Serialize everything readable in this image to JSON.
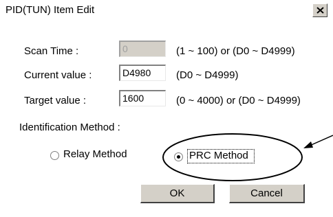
{
  "window": {
    "title": "PID(TUN) Item Edit",
    "close_glyph": "×"
  },
  "fields": {
    "scan_time": {
      "label": "Scan Time :",
      "value": "0",
      "range": "(1 ~ 100) or (D0 ~ D4999)",
      "disabled": true
    },
    "current_value": {
      "label": "Current value :",
      "value": "D4980",
      "range": "(D0 ~ D4999)"
    },
    "target_value": {
      "label": "Target value :",
      "value": "1600",
      "range": "(0 ~ 4000) or (D0 ~ D4999)"
    }
  },
  "identification": {
    "label": "Identification Method :",
    "options": [
      {
        "label": "Relay Method",
        "selected": false
      },
      {
        "label": "PRC Method",
        "selected": true
      }
    ]
  },
  "buttons": {
    "ok": "OK",
    "cancel": "Cancel"
  },
  "annotation": {
    "color": "#000000",
    "shape": "ellipse-with-arrow"
  }
}
